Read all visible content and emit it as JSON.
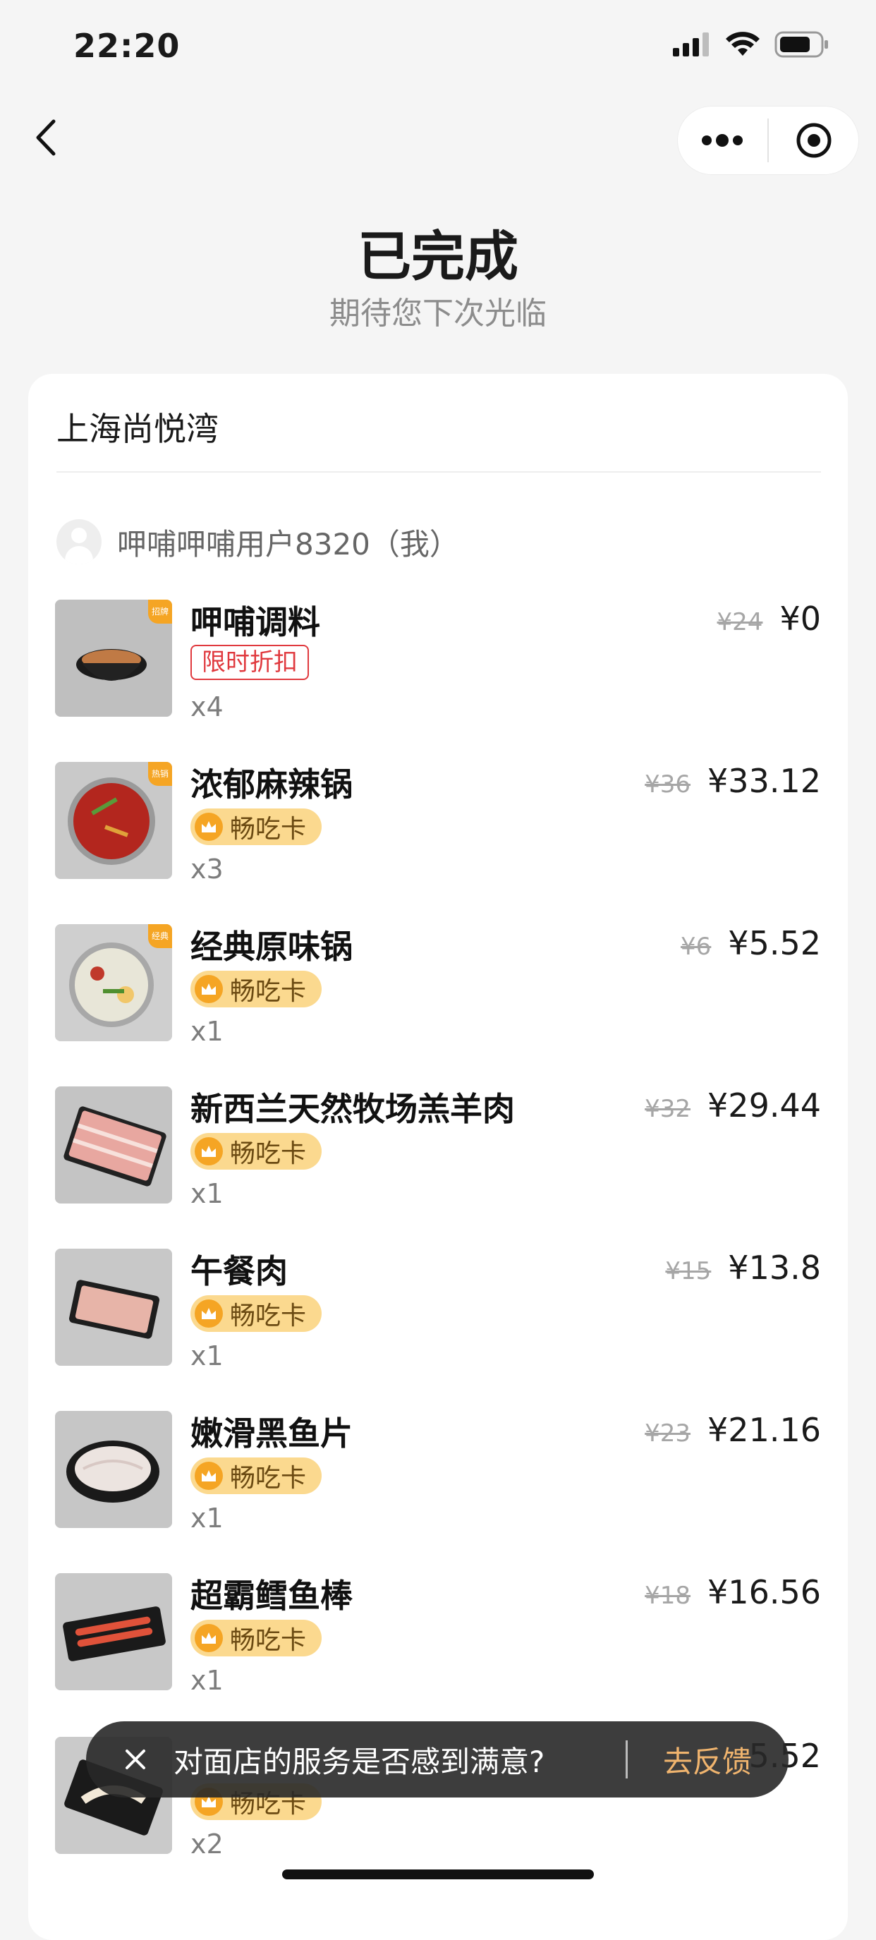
{
  "status_bar": {
    "time": "22:20"
  },
  "header": {
    "title": "已完成",
    "subtitle": "期待您下次光临"
  },
  "store": {
    "name": "上海尚悦湾"
  },
  "user": {
    "name": "呷哺呷哺用户8320（我）"
  },
  "items": [
    {
      "name": "呷哺调料",
      "badge": "限时折扣",
      "badge_type": "discount",
      "qty": "x4",
      "original_price": "¥24",
      "price": "¥0",
      "tag": "招牌"
    },
    {
      "name": "浓郁麻辣锅",
      "badge": "畅吃卡",
      "badge_type": "card",
      "qty": "x3",
      "original_price": "¥36",
      "price": "¥33.12",
      "tag": "热销"
    },
    {
      "name": "经典原味锅",
      "badge": "畅吃卡",
      "badge_type": "card",
      "qty": "x1",
      "original_price": "¥6",
      "price": "¥5.52",
      "tag": "经典"
    },
    {
      "name": "新西兰天然牧场羔羊肉",
      "badge": "畅吃卡",
      "badge_type": "card",
      "qty": "x1",
      "original_price": "¥32",
      "price": "¥29.44"
    },
    {
      "name": "午餐肉",
      "badge": "畅吃卡",
      "badge_type": "card",
      "qty": "x1",
      "original_price": "¥15",
      "price": "¥13.8"
    },
    {
      "name": "嫩滑黑鱼片",
      "badge": "畅吃卡",
      "badge_type": "card",
      "qty": "x1",
      "original_price": "¥23",
      "price": "¥21.16"
    },
    {
      "name": "超霸鳕鱼棒",
      "badge": "畅吃卡",
      "badge_type": "card",
      "qty": "x1",
      "original_price": "¥18",
      "price": "¥16.56"
    },
    {
      "name": "",
      "badge": "畅吃卡",
      "badge_type": "card",
      "qty": "x2",
      "original_price": "",
      "price": "5.52"
    }
  ],
  "toast": {
    "message": "对面店的服务是否感到满意?",
    "action": "去反馈"
  }
}
